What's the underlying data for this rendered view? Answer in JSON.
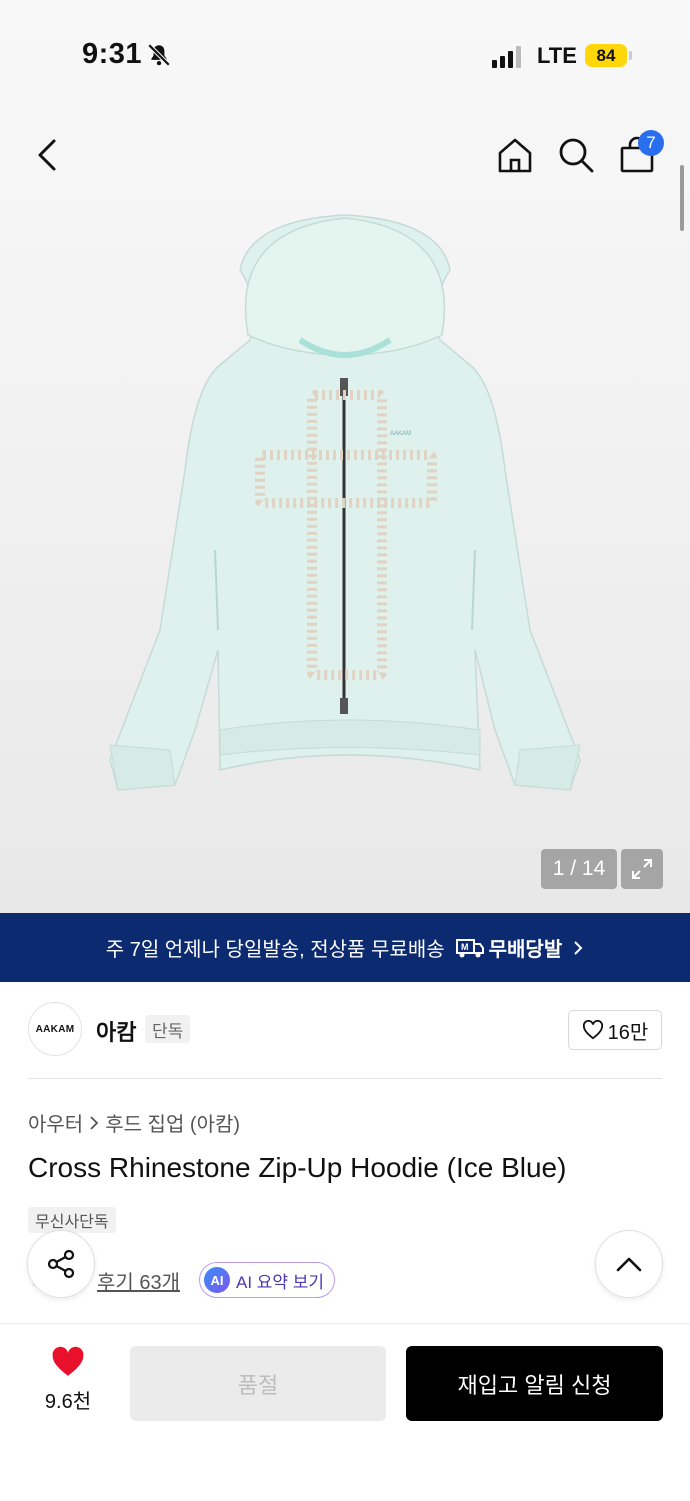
{
  "status_bar": {
    "time": "9:31",
    "network": "LTE",
    "battery": "84"
  },
  "nav": {
    "cart_count": "7"
  },
  "gallery": {
    "counter": "1 / 14"
  },
  "banner": {
    "text": "주 7일 언제나 당일발송, 전상품 무료배송",
    "brand": "무배당발"
  },
  "brand": {
    "logo_text": "AAKAM",
    "name": "아캄",
    "tag": "단독",
    "likes": "16만"
  },
  "breadcrumb": {
    "category": "아우터",
    "subcategory": "후드 집업 (아캄)"
  },
  "product": {
    "title": "Cross Rhinestone Zip-Up Hoodie (Ice Blue)",
    "exclusive_tag": "무신사단독",
    "review_link": "후기 63개",
    "ai_badge": "AI",
    "ai_summary": "AI 요약 보기"
  },
  "bottom_bar": {
    "wish_count": "9.6천",
    "soldout_label": "품절",
    "restock_label": "재입고 알림 신청"
  },
  "colors": {
    "banner_bg": "#0c2a6f",
    "badge_blue": "#2a6ef0",
    "heart_red": "#e8102a",
    "battery_yellow": "#ffd60a"
  }
}
